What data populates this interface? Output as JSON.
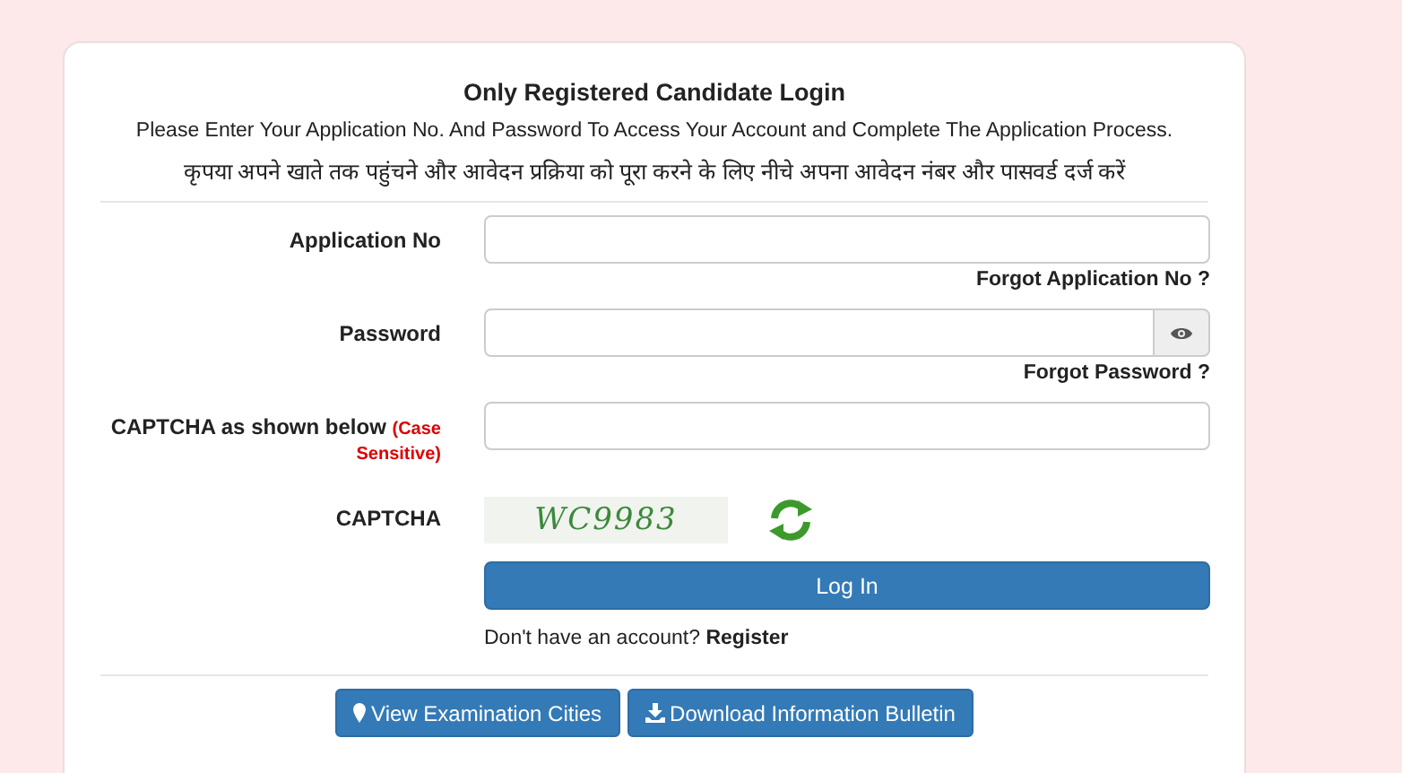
{
  "heading": {
    "title": "Only Registered Candidate Login",
    "instruction": "Please Enter Your Application No. And Password To Access Your Account and Complete The Application Process.",
    "instruction_hindi": "कृपया अपने खाते तक पहुंचने और आवेदन प्रक्रिया को पूरा करने के लिए नीचे अपना आवेदन नंबर और पासवर्ड दर्ज करें"
  },
  "fields": [
    {
      "kind": "text",
      "label": "Application No",
      "link": "Forgot Application No ?"
    },
    {
      "kind": "password",
      "label": "Password",
      "link": "Forgot Password ?"
    },
    {
      "kind": "captcha-input",
      "label": "CAPTCHA as shown below",
      "note": "(Case Sensitive)"
    }
  ],
  "captcha": {
    "label": "CAPTCHA",
    "code": "WC9983"
  },
  "login_button": "Log In",
  "register": {
    "prompt": "Don't have an account?",
    "link": "Register"
  },
  "footer_buttons": [
    {
      "kind": "map",
      "label": "View Examination Cities"
    },
    {
      "kind": "download",
      "label": "Download Information Bulletin"
    }
  ]
}
